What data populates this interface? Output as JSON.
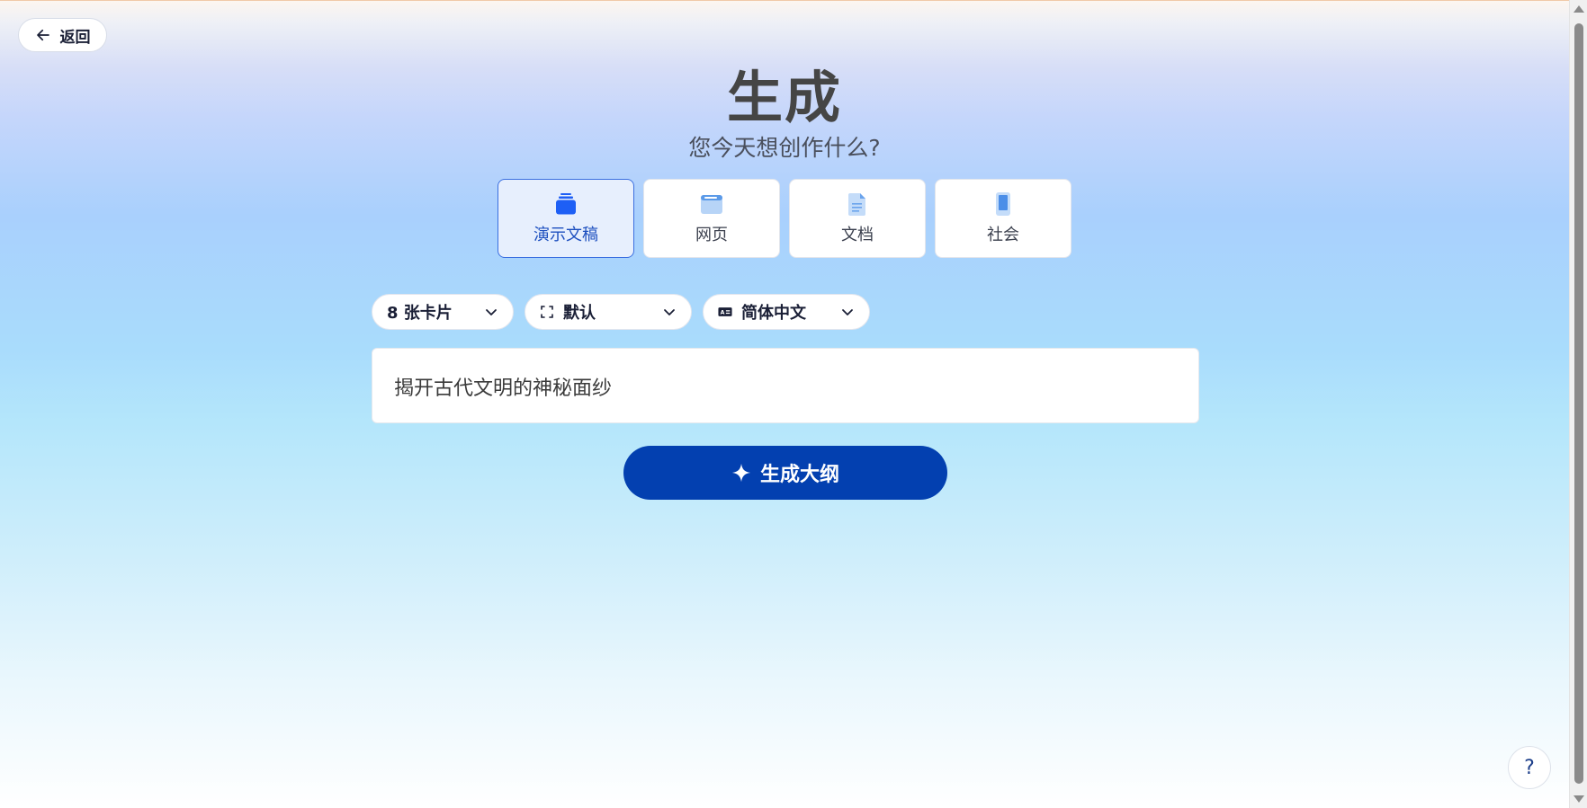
{
  "back": {
    "label": "返回"
  },
  "header": {
    "title": "生成",
    "subtitle": "您今天想创作什么?"
  },
  "types": [
    {
      "label": "演示文稿",
      "icon": "presentation-icon",
      "active": true
    },
    {
      "label": "网页",
      "icon": "webpage-icon",
      "active": false
    },
    {
      "label": "文档",
      "icon": "document-icon",
      "active": false
    },
    {
      "label": "社会",
      "icon": "social-phone-icon",
      "active": false
    }
  ],
  "options": {
    "cards": "8 张卡片",
    "format": "默认",
    "language": "简体中文"
  },
  "prompt": {
    "value": "揭开古代文明的神秘面纱"
  },
  "generate": {
    "label": "生成大纲"
  },
  "help": {
    "label": "?"
  },
  "colors": {
    "primary": "#0340b0",
    "active_border": "#3b6fe0",
    "active_bg": "#e7effd"
  }
}
